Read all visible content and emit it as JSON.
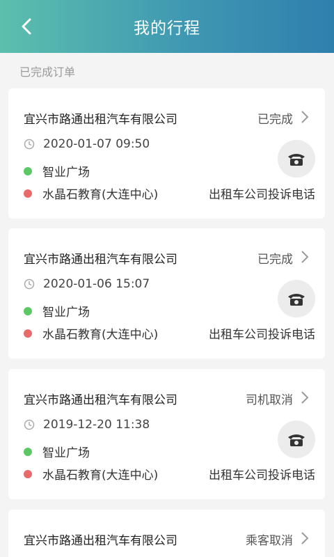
{
  "header": {
    "title": "我的行程"
  },
  "section_label": "已完成订单",
  "orders": [
    {
      "company": "宜兴市路通出租汽车有限公司",
      "status": "已完成",
      "time": "2020-01-07 09:50",
      "from": "智业广场",
      "to": "水晶石教育(大连中心)",
      "complaint": "出租车公司投诉电话"
    },
    {
      "company": "宜兴市路通出租汽车有限公司",
      "status": "已完成",
      "time": "2020-01-06 15:07",
      "from": "智业广场",
      "to": "水晶石教育(大连中心)",
      "complaint": "出租车公司投诉电话"
    },
    {
      "company": "宜兴市路通出租汽车有限公司",
      "status": "司机取消",
      "time": "2019-12-20 11:38",
      "from": "智业广场",
      "to": "水晶石教育(大连中心)",
      "complaint": "出租车公司投诉电话"
    },
    {
      "company": "宜兴市路通出租汽车有限公司",
      "status": "乘客取消"
    }
  ],
  "colors": {
    "header_gradient_start": "#5cbfad",
    "header_gradient_end": "#2f7fae",
    "start_dot": "#5cc765",
    "end_dot": "#e86a6a"
  }
}
